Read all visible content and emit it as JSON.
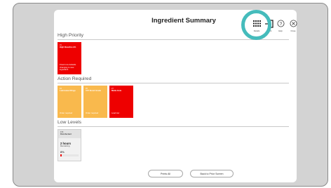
{
  "panel": {
    "title": "Ingredient Summary"
  },
  "toolbar": [
    {
      "label": "Details",
      "icon": "grid-icon"
    },
    {
      "label": "Back",
      "icon": "exit-icon"
    },
    {
      "label": "Help",
      "icon": "help-icon"
    },
    {
      "label": "Close",
      "icon": "close-icon"
    }
  ],
  "sections": {
    "high_priority": {
      "title": "High Priority",
      "cards": [
        {
          "id": "#1",
          "name": "High Baseline Alt.",
          "note": "Fixed now defaults changing to new ingredient",
          "color": "#ee0000"
        }
      ]
    },
    "action_required": {
      "title": "Action Required",
      "cards": [
        {
          "id": "#4",
          "name": "Lubricated Rings",
          "note": "Order required",
          "color": "#f9b94d"
        },
        {
          "id": "#5",
          "name": "VFT Bond Grade",
          "note": "Order required",
          "color": "#f9b94d"
        },
        {
          "id": "#7",
          "name": "Matte Hole",
          "note": "Load low",
          "color": "#ee0000"
        }
      ]
    },
    "low_levels": {
      "title": "Low Levels",
      "cards": [
        {
          "id": "#16",
          "name": "Disinfectant",
          "time": "2 hours",
          "sub": "Remaining",
          "percent": "8%",
          "fill": 0.08
        }
      ]
    }
  },
  "buttons": {
    "print_all": "Prints All",
    "back": "Back to Prior Screen"
  }
}
